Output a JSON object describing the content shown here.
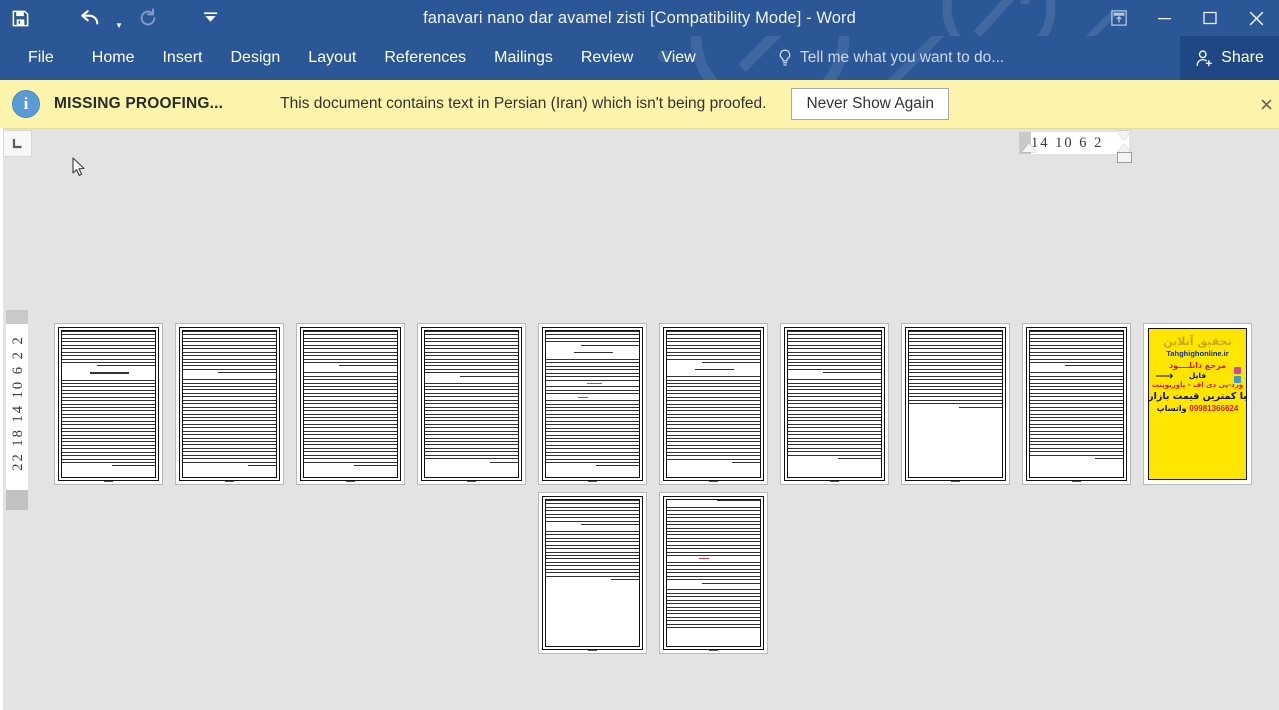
{
  "window": {
    "title": "fanavari nano dar avamel zisti [Compatibility Mode] - Word",
    "quick_access": [
      {
        "name": "save-icon",
        "label": "Save"
      },
      {
        "name": "undo-icon",
        "label": "Undo"
      },
      {
        "name": "redo-icon",
        "label": "Redo"
      },
      {
        "name": "customize-qat-icon",
        "label": "Customize Quick Access Toolbar"
      }
    ],
    "controls": {
      "ribbon_display": "Ribbon Display Options",
      "minimize": "─",
      "maximize": "☐",
      "close": "✕"
    }
  },
  "ribbon": {
    "tabs": [
      {
        "label": "File"
      },
      {
        "label": "Home"
      },
      {
        "label": "Insert"
      },
      {
        "label": "Design"
      },
      {
        "label": "Layout"
      },
      {
        "label": "References"
      },
      {
        "label": "Mailings"
      },
      {
        "label": "Review"
      },
      {
        "label": "View"
      }
    ],
    "tell_me": "Tell me what you want to do...",
    "share": "Share"
  },
  "message_bar": {
    "title": "MISSING PROOFING...",
    "text": "This document contains text in Persian (Iran) which isn't being proofed.",
    "button": "Never Show Again",
    "close": "✕",
    "info_glyph": "i",
    "background": "#fcf4ab"
  },
  "rulers": {
    "horizontal_ticks": "14  10   6    2",
    "vertical_ticks": "22 18 14 10  6   2   2",
    "tab_selector": "left-tab-stop"
  },
  "colors": {
    "titlebar": "#2b5797",
    "share_button": "#1f4685",
    "workspace": "#e3e3e3",
    "message_bar": "#fcf4ab",
    "ad_page": "#ffe600"
  },
  "document": {
    "view": "multiple-pages",
    "page_count": 12,
    "pages": [
      {
        "n": 1,
        "type": "text"
      },
      {
        "n": 2,
        "type": "text"
      },
      {
        "n": 3,
        "type": "text"
      },
      {
        "n": 4,
        "type": "text"
      },
      {
        "n": 5,
        "type": "text-with-markup"
      },
      {
        "n": 6,
        "type": "text"
      },
      {
        "n": 7,
        "type": "text"
      },
      {
        "n": 8,
        "type": "text-partial"
      },
      {
        "n": 9,
        "type": "text"
      },
      {
        "n": 10,
        "type": "advertisement"
      },
      {
        "n": 11,
        "type": "text-partial"
      },
      {
        "n": 12,
        "type": "text-with-markup"
      }
    ]
  },
  "advertisement": {
    "heading": "تحقیق آنلاین",
    "site": "Tahghighonline.ir",
    "line3": "مرجع دانلــــود",
    "line4": "فایل",
    "line5": "ورد-پی دی اف - پاورپوینت",
    "line6": "با کمترین قیمت بازار",
    "phone": "09981366624",
    "whatsapp": "واتساپ"
  }
}
